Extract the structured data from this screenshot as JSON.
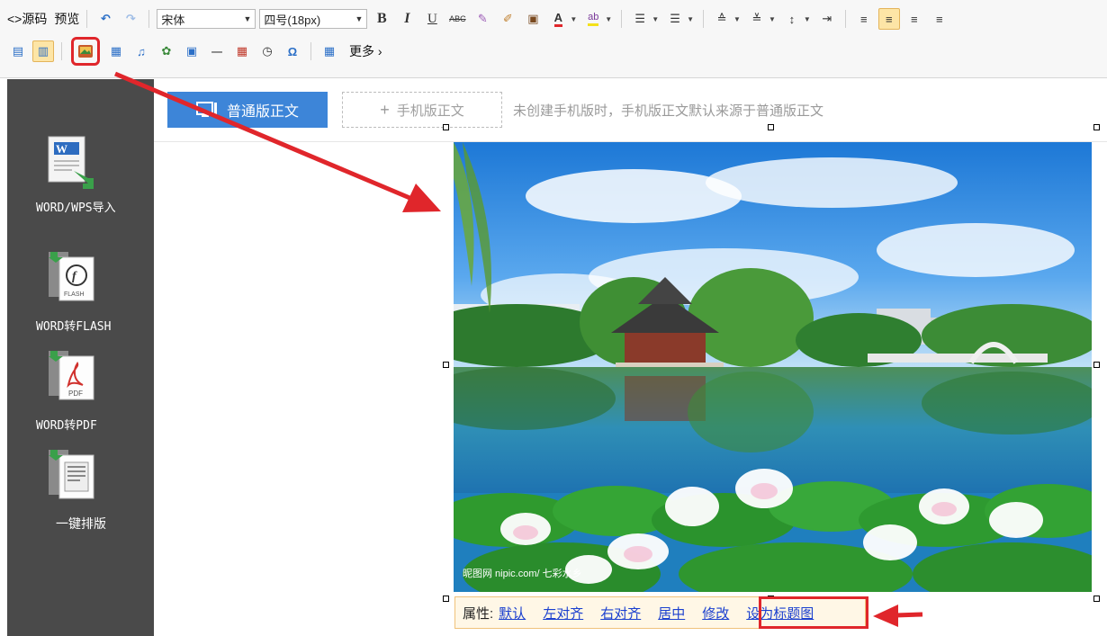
{
  "toolbar": {
    "source_label": "源码",
    "preview_label": "预览",
    "font_family": "宋体",
    "font_size": "四号(18px)",
    "bold": "B",
    "italic": "I",
    "underline": "U",
    "strike": "ABC",
    "font_color_glyph": "A",
    "bg_color_glyph": "ab",
    "hr_glyph": "一",
    "omega_glyph": "Ω",
    "more_label": "更多"
  },
  "sidebar": {
    "items": [
      {
        "label": "WORD/WPS导入",
        "icon": "word-import-icon",
        "badge": "W"
      },
      {
        "label": "WORD转FLASH",
        "icon": "word-to-flash-icon",
        "badge": "FLASH"
      },
      {
        "label": "WORD转PDF",
        "icon": "word-to-pdf-icon",
        "badge": "PDF"
      },
      {
        "label": "一键排版",
        "icon": "one-click-layout-icon"
      }
    ]
  },
  "editor": {
    "tab_normal": "普通版正文",
    "tab_mobile": "手机版正文",
    "mobile_hint": "未创建手机版时，手机版正文默认来源于普通版正文",
    "watermark": "昵图网 nipic.com/ 七彩水乡"
  },
  "image_toolbar": {
    "label": "属性:",
    "actions": [
      "默认",
      "左对齐",
      "右对齐",
      "居中",
      "修改",
      "设为标题图"
    ]
  },
  "colors": {
    "accent_blue": "#3d85d8",
    "highlight_red": "#e0262b",
    "sidebar_bg": "#4a4a4a",
    "link_blue": "#1a3fcf"
  }
}
